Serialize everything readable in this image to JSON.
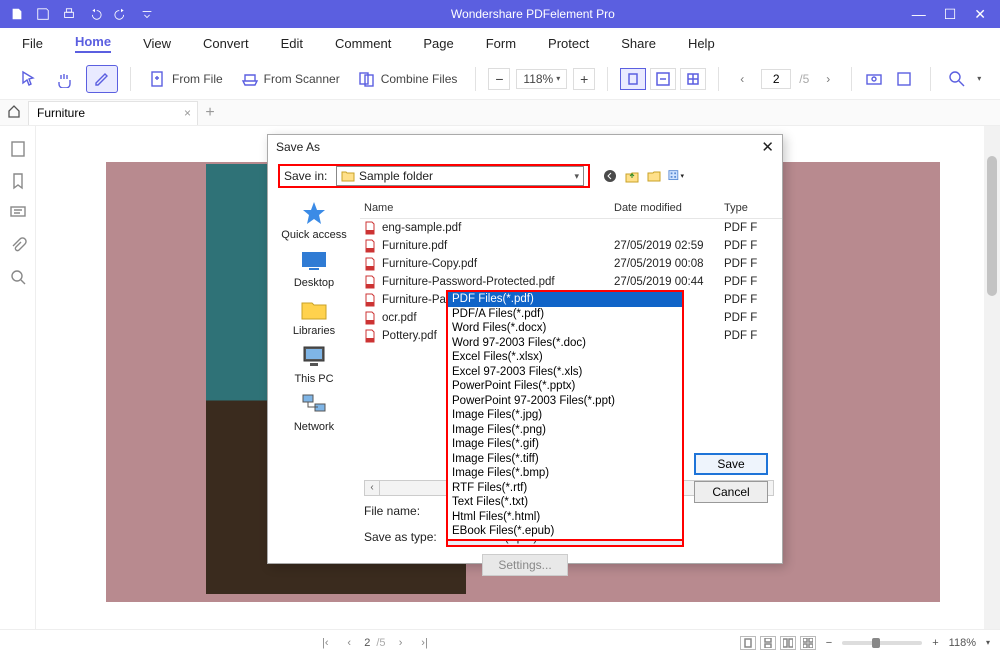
{
  "app_title": "Wondershare PDFelement Pro",
  "menu": [
    "File",
    "Home",
    "View",
    "Convert",
    "Edit",
    "Comment",
    "Page",
    "Form",
    "Protect",
    "Share",
    "Help"
  ],
  "active_menu": "Home",
  "ribbon": {
    "from_file": "From File",
    "from_scanner": "From Scanner",
    "combine": "Combine Files",
    "zoom": "118%",
    "page_current": "2",
    "page_total": "/5"
  },
  "tab": {
    "name": "Furniture"
  },
  "dialog": {
    "title": "Save As",
    "savein_label": "Save in:",
    "savein_value": "Sample folder",
    "places": [
      "Quick access",
      "Desktop",
      "Libraries",
      "This PC",
      "Network"
    ],
    "cols": {
      "name": "Name",
      "date": "Date modified",
      "type": "Type"
    },
    "rows": [
      {
        "name": "eng-sample.pdf",
        "date": "",
        "type": "PDF F"
      },
      {
        "name": "Furniture.pdf",
        "date": "27/05/2019 02:59",
        "type": "PDF F"
      },
      {
        "name": "Furniture-Copy.pdf",
        "date": "27/05/2019 00:08",
        "type": "PDF F"
      },
      {
        "name": "Furniture-Password-Protected.pdf",
        "date": "27/05/2019 00:44",
        "type": "PDF F"
      },
      {
        "name": "Furniture-Pa",
        "date": "2:20",
        "type": "PDF F"
      },
      {
        "name": "ocr.pdf",
        "date": "0:02",
        "type": "PDF F"
      },
      {
        "name": "Pottery.pdf",
        "date": "",
        "type": "PDF F"
      }
    ],
    "filename_label": "File name:",
    "filename_value": "",
    "type_label": "Save as type:",
    "type_value": "PDF Files(*.pdf)",
    "save_btn": "Save",
    "cancel_btn": "Cancel",
    "settings_btn": "Settings..."
  },
  "type_options": [
    "PDF Files(*.pdf)",
    "PDF/A Files(*.pdf)",
    "Word Files(*.docx)",
    "Word 97-2003 Files(*.doc)",
    "Excel Files(*.xlsx)",
    "Excel 97-2003 Files(*.xls)",
    "PowerPoint Files(*.pptx)",
    "PowerPoint 97-2003 Files(*.ppt)",
    "Image Files(*.jpg)",
    "Image Files(*.png)",
    "Image Files(*.gif)",
    "Image Files(*.tiff)",
    "Image Files(*.bmp)",
    "RTF Files(*.rtf)",
    "Text Files(*.txt)",
    "Html Files(*.html)",
    "EBook Files(*.epub)"
  ],
  "status": {
    "page_current": "2",
    "page_total": "/5",
    "zoom": "118%"
  }
}
